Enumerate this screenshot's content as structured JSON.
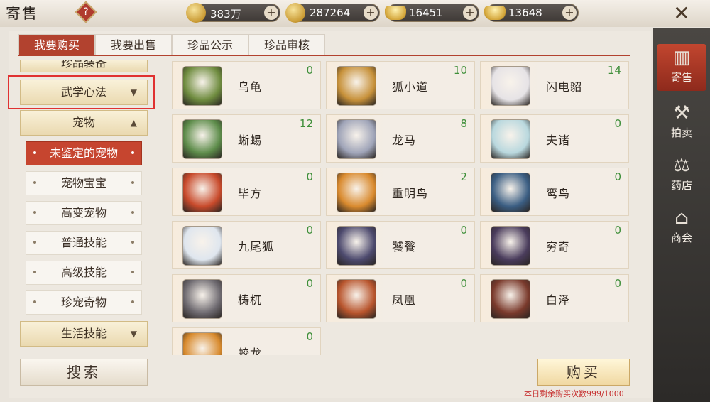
{
  "window": {
    "title": "寄售",
    "help_icon": "?"
  },
  "currencies": [
    {
      "icon": "coin-stack-icon",
      "value": "383万"
    },
    {
      "icon": "gold-coin-icon",
      "value": "287264"
    },
    {
      "icon": "silver-ingot-icon",
      "value": "16451"
    },
    {
      "icon": "gold-ingot-icon",
      "value": "13648"
    }
  ],
  "plus_label": "+",
  "close_icon": "✕",
  "tabs": [
    "我要购买",
    "我要出售",
    "珍品公示",
    "珍品审核"
  ],
  "categories": {
    "top_partial": "珍品装备",
    "martial": "武学心法",
    "pets": "宠物",
    "life": "生活技能",
    "arrow_down": "▼",
    "arrow_up": "▲"
  },
  "pet_subs": [
    "未鉴定的宠物",
    "宠物宝宝",
    "高变宠物",
    "普通技能",
    "高级技能",
    "珍宠奇物"
  ],
  "search_label": "搜索",
  "items": [
    {
      "name": "乌龟",
      "count": "0",
      "color": "#6f8c3f"
    },
    {
      "name": "狐小道",
      "count": "10",
      "color": "#c7913a"
    },
    {
      "name": "闪电貂",
      "count": "14",
      "color": "#e6e3e6"
    },
    {
      "name": "蜥蜴",
      "count": "12",
      "color": "#5d8c4a"
    },
    {
      "name": "龙马",
      "count": "8",
      "color": "#9fa4b8"
    },
    {
      "name": "夫诸",
      "count": "0",
      "color": "#b9d8de"
    },
    {
      "name": "毕方",
      "count": "0",
      "color": "#c84a2b"
    },
    {
      "name": "重明鸟",
      "count": "2",
      "color": "#d98a2e"
    },
    {
      "name": "鸾鸟",
      "count": "0",
      "color": "#3b5e83"
    },
    {
      "name": "九尾狐",
      "count": "0",
      "color": "#dfe6ee"
    },
    {
      "name": "饕餮",
      "count": "0",
      "color": "#4d4a6e"
    },
    {
      "name": "穷奇",
      "count": "0",
      "color": "#4a3c5c"
    },
    {
      "name": "梼杌",
      "count": "0",
      "color": "#6e6a70"
    },
    {
      "name": "凤凰",
      "count": "0",
      "color": "#b8552d"
    },
    {
      "name": "白泽",
      "count": "0",
      "color": "#7a3a2c"
    },
    {
      "name": "蛟龙",
      "count": "0",
      "color": "#d88a2d"
    }
  ],
  "buy_label": "购买",
  "buy_limit": "本日剩余购买次数999/1000",
  "nav": [
    {
      "label": "寄售",
      "icon": "▥"
    },
    {
      "label": "拍卖",
      "icon": "⚒"
    },
    {
      "label": "药店",
      "icon": "⚖"
    },
    {
      "label": "商会",
      "icon": "⌂"
    }
  ]
}
